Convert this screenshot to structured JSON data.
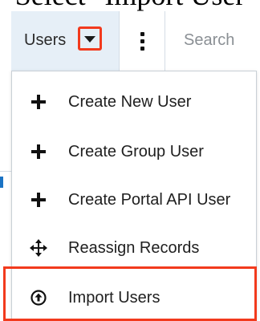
{
  "caption": "Select \"Import User",
  "module_tab": {
    "label": "Users"
  },
  "search": {
    "placeholder": "Search"
  },
  "menu": {
    "items": [
      {
        "label": "Create New User",
        "icon": "plus-icon"
      },
      {
        "label": "Create Group User",
        "icon": "plus-icon"
      },
      {
        "label": "Create Portal API User",
        "icon": "plus-icon"
      },
      {
        "label": "Reassign Records",
        "icon": "move-arrows-icon"
      },
      {
        "label": "Import Users",
        "icon": "upload-circle-icon"
      }
    ]
  },
  "colors": {
    "highlight": "#f23a1d",
    "tab_background": "#e6eff7",
    "accent": "#1b73c4"
  }
}
